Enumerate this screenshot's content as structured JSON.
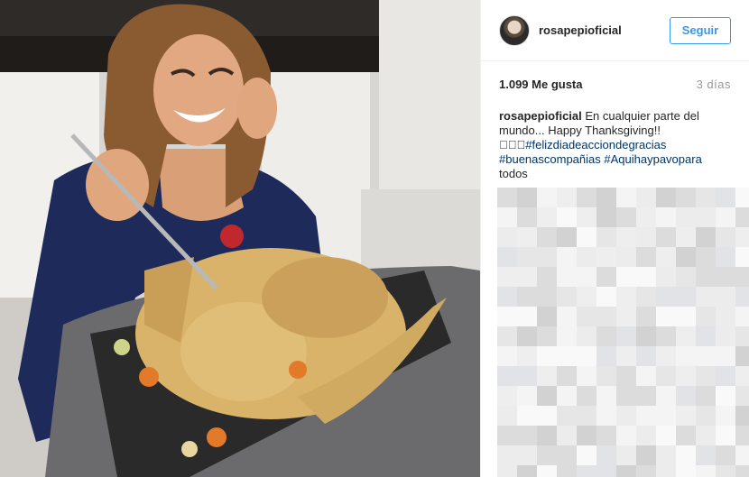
{
  "post": {
    "username": "rosapepioficial",
    "follow_label": "Seguir",
    "likes": "1.099 Me gusta",
    "time": "3 días",
    "caption": {
      "user": "rosapepioficial",
      "text": "En cualquier parte del mundo... Happy Thanksgiving!!",
      "emoji": "\u0000\u0000\u0000",
      "hashtags": [
        "#felizdiadeacciondegracias",
        "#buenascompañias",
        "#Aquihaypavopara"
      ],
      "tail": "todos"
    }
  },
  "photo": {
    "description_icon": "photo-image"
  },
  "colors": {
    "accent": "#3897f0",
    "hashtag": "#003569",
    "muted": "#999999"
  }
}
